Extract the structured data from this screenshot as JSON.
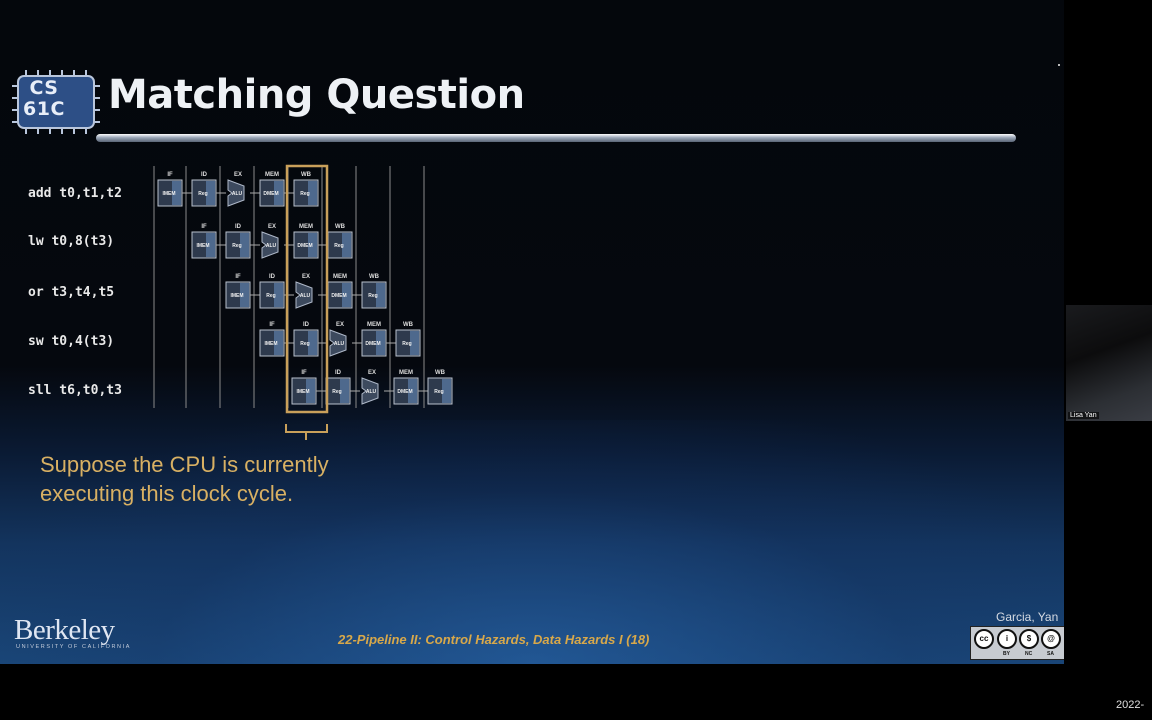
{
  "slide": {
    "logo": {
      "line1": "CS",
      "line2": "61C",
      "icon": "cs61c-chip-logo"
    },
    "title": "Matching Question",
    "instructions": [
      {
        "text": "add t0,t1,t2"
      },
      {
        "text": "lw t0,8(t3)"
      },
      {
        "text": "or t3,t4,t5"
      },
      {
        "text": "sw t0,4(t3)"
      },
      {
        "text": "sll t6,t0,t3"
      }
    ],
    "stage_headers": [
      "IF",
      "ID",
      "EX",
      "MEM",
      "WB"
    ],
    "stage_units": [
      "IMEM",
      "Reg",
      "ALU",
      "DMEM",
      "Reg"
    ],
    "callout": "Suppose the CPU is currently executing this clock cycle.",
    "highlight_color": "#c9a05a",
    "footer": {
      "course_title": "22-Pipeline II: Control Hazards, Data Hazards I",
      "slide_number": "(18)"
    },
    "berkeley": {
      "name": "Berkeley",
      "subtitle": "UNIVERSITY OF CALIFORNIA"
    },
    "authors": "Garcia, Yan",
    "license": {
      "icons": [
        "cc-icon",
        "by-icon",
        "nc-icon",
        "sa-icon"
      ],
      "labels": [
        "BY",
        "NC",
        "SA"
      ]
    }
  },
  "webcam": {
    "name": "Lisa Yan"
  },
  "timestamp": "2022-"
}
